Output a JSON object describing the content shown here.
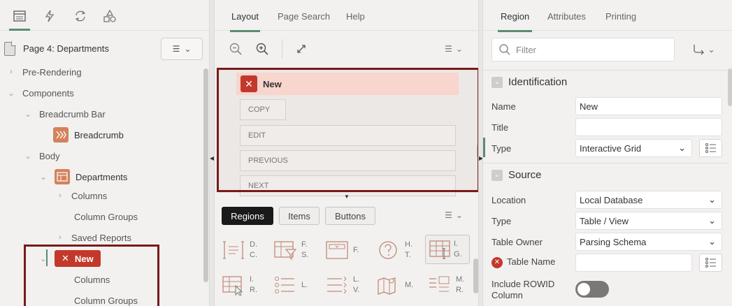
{
  "left": {
    "tool_tabs": [
      "rendering-icon",
      "dynamic-actions-icon",
      "processing-icon",
      "shared-components-icon"
    ],
    "page_title": "Page 4: Departments",
    "tree": {
      "pre_rendering": "Pre-Rendering",
      "components": "Components",
      "breadcrumb_bar": "Breadcrumb Bar",
      "breadcrumb": "Breadcrumb",
      "body": "Body",
      "departments": "Departments",
      "columns": "Columns",
      "column_groups": "Column Groups",
      "saved_reports": "Saved Reports",
      "new_region": "New",
      "new_columns": "Columns",
      "new_column_groups": "Column Groups"
    }
  },
  "center": {
    "tabs": {
      "layout": "Layout",
      "page_search": "Page Search",
      "help": "Help"
    },
    "region_title": "New",
    "layout_buttons": {
      "copy": "COPY",
      "edit": "EDIT",
      "previous": "PREVIOUS",
      "next": "NEXT"
    },
    "gallery_tabs": {
      "regions": "Regions",
      "items": "Items",
      "buttons": "Buttons"
    },
    "gallery_items": [
      {
        "l1": "D.",
        "l2": "C."
      },
      {
        "l1": "F.",
        "l2": "S."
      },
      {
        "l1": "F.",
        "l2": ""
      },
      {
        "l1": "H.",
        "l2": "T."
      },
      {
        "l1": "I.",
        "l2": "G."
      },
      {
        "l1": "I.",
        "l2": "R."
      },
      {
        "l1": "L.",
        "l2": ""
      },
      {
        "l1": "L.",
        "l2": "V."
      },
      {
        "l1": "M.",
        "l2": ""
      },
      {
        "l1": "M.",
        "l2": "R."
      }
    ]
  },
  "right": {
    "tabs": {
      "region": "Region",
      "attributes": "Attributes",
      "printing": "Printing"
    },
    "filter_placeholder": "Filter",
    "identification": {
      "title": "Identification",
      "name_label": "Name",
      "name_value": "New",
      "title_label": "Title",
      "title_value": "",
      "type_label": "Type",
      "type_value": "Interactive Grid"
    },
    "source": {
      "title": "Source",
      "location_label": "Location",
      "location_value": "Local Database",
      "type_label": "Type",
      "type_value": "Table / View",
      "owner_label": "Table Owner",
      "owner_value": "Parsing Schema",
      "table_label": "Table Name",
      "table_value": "",
      "rowid_label_1": "Include ROWID",
      "rowid_label_2": "Column"
    }
  },
  "colors": {
    "accent_green": "#5b8c6f",
    "error_red": "#c2392b",
    "callout": "#7a1a1a",
    "highlight": "#f8d5cd"
  }
}
